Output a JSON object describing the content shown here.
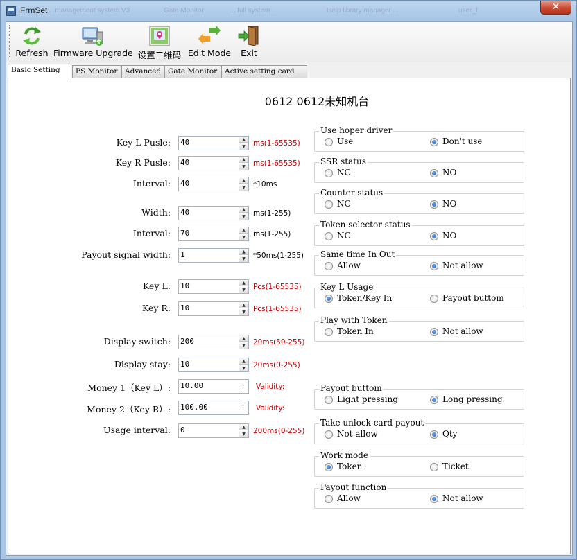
{
  "window": {
    "title": "FrmSet",
    "close_glyph": "✕",
    "background_titles": [
      "...management system V3",
      "Gate Monitor",
      "... full system ...",
      "Help library manager ...",
      "user_f"
    ]
  },
  "toolbar": {
    "items": [
      {
        "label": "Refresh",
        "icon": "refresh-icon"
      },
      {
        "label": "Firmware Upgrade",
        "icon": "computer-upgrade-icon"
      },
      {
        "label": "设置二维码",
        "icon": "qrcode-icon"
      },
      {
        "label": "Edit Mode",
        "icon": "arrows-swap-icon"
      },
      {
        "label": "Exit",
        "icon": "exit-door-icon"
      }
    ]
  },
  "tabs": [
    "Basic Setting",
    "PS Monitor",
    "Advanced",
    "Gate Monitor",
    "Active setting card"
  ],
  "active_tab": "Basic Setting",
  "heading": "0612  0612未知机台",
  "fields": [
    {
      "label": "Key L Pusle:",
      "value": "40",
      "unit": "ms(1-65535)",
      "unit_color": "red",
      "spin": true
    },
    {
      "label": "Key R Pusle:",
      "value": "40",
      "unit": "ms(1-65535)",
      "unit_color": "red",
      "spin": true
    },
    {
      "label": "Interval:",
      "value": "40",
      "unit": "*10ms",
      "unit_color": "black",
      "spin": true
    },
    {
      "label": "Width:",
      "value": "40",
      "unit": "ms(1-255)",
      "unit_color": "black",
      "spin": true
    },
    {
      "label": "Interval:",
      "value": "70",
      "unit": "ms(1-255)",
      "unit_color": "black",
      "spin": true
    },
    {
      "label": "Payout signal width:",
      "value": "1",
      "unit": "*50ms(1-255)",
      "unit_color": "black",
      "spin": true
    },
    {
      "label": "Key L:",
      "value": "10",
      "unit": "Pcs(1-65535)",
      "unit_color": "red",
      "spin": true
    },
    {
      "label": "Key R:",
      "value": "10",
      "unit": "Pcs(1-65535)",
      "unit_color": "red",
      "spin": true
    },
    {
      "label": "Display switch:",
      "value": "200",
      "unit": "20ms(50-255)",
      "unit_color": "red",
      "spin": true
    },
    {
      "label": "Display stay:",
      "value": "10",
      "unit": "20ms(0-255)",
      "unit_color": "red",
      "spin": true
    },
    {
      "label": "Money 1（Key L）:",
      "value": "10.00",
      "unit": "Validity:",
      "unit_color": "red",
      "spin": false
    },
    {
      "label": "Money 2（Key R）:",
      "value": "100.00",
      "unit": "Validity:",
      "unit_color": "red",
      "spin": false
    },
    {
      "label": "Usage interval:",
      "value": "0",
      "unit": "200ms(0-255)",
      "unit_color": "red",
      "spin": true
    }
  ],
  "groups": [
    {
      "title": "Use hoper driver",
      "options": [
        "Use",
        "Don't use"
      ],
      "selected": 1
    },
    {
      "title": "SSR status",
      "options": [
        "NC",
        "NO"
      ],
      "selected": 1
    },
    {
      "title": "Counter status",
      "options": [
        "NC",
        "NO"
      ],
      "selected": 1
    },
    {
      "title": "Token selector status",
      "options": [
        "NC",
        "NO"
      ],
      "selected": 1
    },
    {
      "title": "Same time In Out",
      "options": [
        "Allow",
        "Not allow"
      ],
      "selected": 1
    },
    {
      "title": "Key L Usage",
      "options": [
        "Token/Key In",
        "Payout buttom"
      ],
      "selected": 0
    },
    {
      "title": "Play with Token",
      "options": [
        "Token In",
        "Not allow"
      ],
      "selected": 1
    },
    {
      "title": "Payout buttom",
      "options": [
        "Light pressing",
        "Long pressing"
      ],
      "selected": 1
    },
    {
      "title": "Take unlock card payout",
      "options": [
        "Not allow",
        "Qty"
      ],
      "selected": 1
    },
    {
      "title": "Work mode",
      "options": [
        "Token",
        "Ticket"
      ],
      "selected": 0
    },
    {
      "title": "Payout function",
      "options": [
        "Allow",
        "Not allow"
      ],
      "selected": 1
    }
  ],
  "colors": {
    "red_unit": "#c00000",
    "radio_selected": "#1d5fbf",
    "title_bar": "#bcd5ee",
    "close_button": "#c94a31"
  }
}
